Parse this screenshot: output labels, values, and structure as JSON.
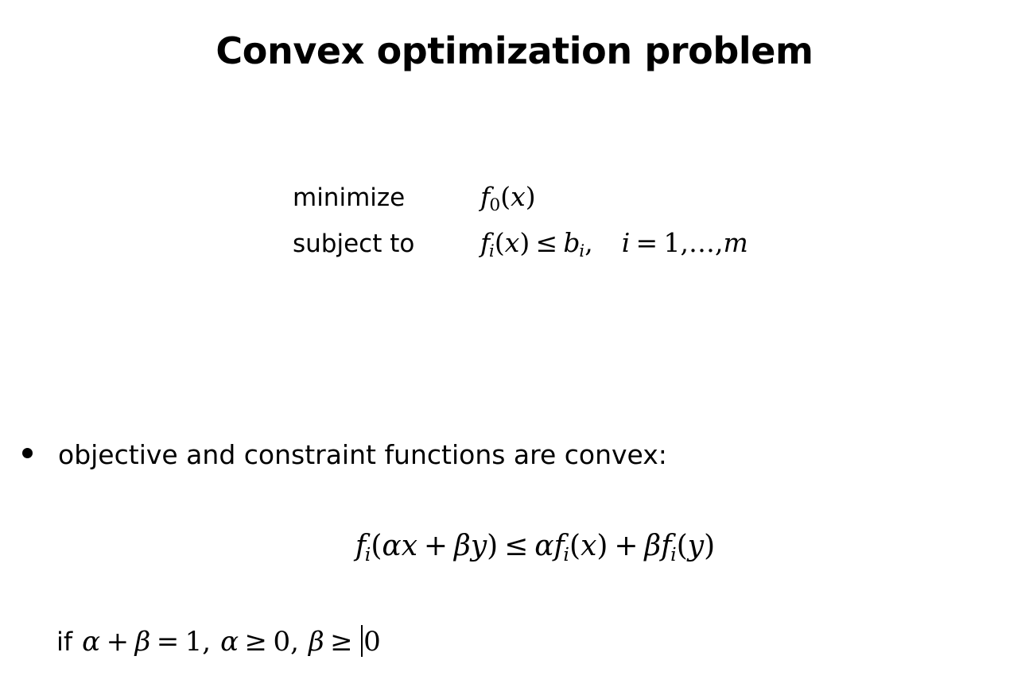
{
  "slide": {
    "title": "Convex optimization problem",
    "background_color": "#ffffff",
    "text_color": "#000000"
  },
  "problem": {
    "rows": [
      {
        "label": "minimize",
        "fn_name": "f",
        "fn_sub": "0",
        "open_paren": "(",
        "arg": "x",
        "close_paren": ")"
      },
      {
        "label": "subject to",
        "fn_name": "f",
        "fn_sub": "i",
        "open_paren": "(",
        "arg": "x",
        "close_paren": ")",
        "relation": "≤",
        "bound_name": "b",
        "bound_sub": "i",
        "comma": ",",
        "index_var": "i",
        "equals": "=",
        "index_start": "1",
        "index_sep": ",",
        "ellipsis": "…",
        "index_sep2": ",",
        "index_end": "m"
      }
    ]
  },
  "bullet": {
    "marker": "•",
    "text": "objective and constraint functions are convex:"
  },
  "equation": {
    "lhs_fn": "f",
    "lhs_sub": "i",
    "lhs_open": "(",
    "alpha": "α",
    "x": "x",
    "plus": "+",
    "beta": "β",
    "y": "y",
    "lhs_close": ")",
    "relation": "≤",
    "rhs_alpha": "α",
    "rhs_fn1": "f",
    "rhs_sub1": "i",
    "rhs_open1": "(",
    "rhs_arg1": "x",
    "rhs_close1": ")",
    "rhs_plus": "+",
    "rhs_beta": "β",
    "rhs_fn2": "f",
    "rhs_sub2": "i",
    "rhs_open2": "(",
    "rhs_arg2": "y",
    "rhs_close2": ")"
  },
  "condition": {
    "if_word": "if",
    "alpha": "α",
    "plus": "+",
    "beta": "β",
    "equals": "=",
    "one": "1",
    "comma1": ",",
    "alpha2": "α",
    "geq1": "≥",
    "zero1": "0",
    "comma2": ",",
    "beta2": "β",
    "geq2": "≥",
    "zero2": "0"
  },
  "caret": {
    "visible": true
  }
}
